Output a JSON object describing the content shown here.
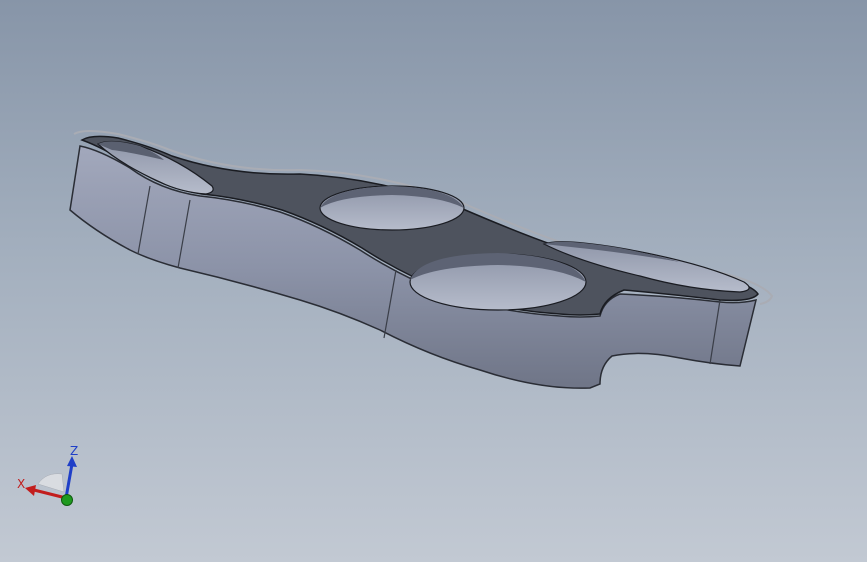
{
  "viewport": {
    "background_top": "#8795a8",
    "background_bottom": "#c2c9d3"
  },
  "model": {
    "description_icon": "part-3d-model",
    "face_color": "#8c93a8",
    "top_color": "#4e535e",
    "edge_color": "#1a1c22",
    "outline_color": "#a9acb4"
  },
  "triad": {
    "x_label": "X",
    "z_label": "Z",
    "x_color": "#c21d1d",
    "z_color": "#1f3fc8",
    "y_color": "#1f9a1f"
  }
}
